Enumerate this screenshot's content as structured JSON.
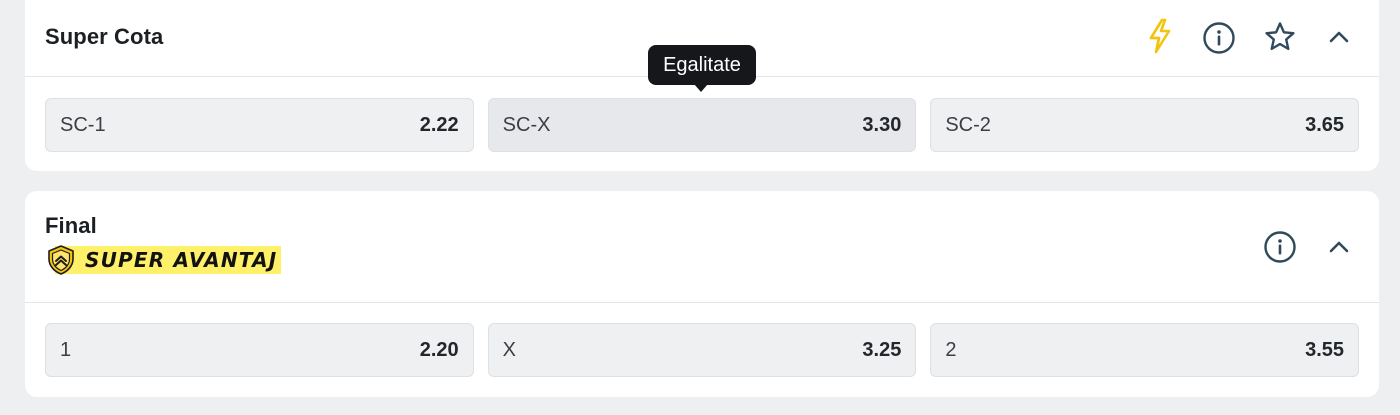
{
  "super_cota": {
    "title": "Super Cota",
    "tooltip": "Egalitate",
    "outcomes": [
      {
        "label": "SC-1",
        "odd": "2.22"
      },
      {
        "label": "SC-X",
        "odd": "3.30"
      },
      {
        "label": "SC-2",
        "odd": "3.65"
      }
    ],
    "icons": [
      "lightning-icon",
      "info-icon",
      "star-icon",
      "chevron-up-icon"
    ]
  },
  "final": {
    "title": "Final",
    "badge": "SUPER AVANTAJ",
    "outcomes": [
      {
        "label": "1",
        "odd": "2.20"
      },
      {
        "label": "X",
        "odd": "3.25"
      },
      {
        "label": "2",
        "odd": "3.55"
      }
    ],
    "icons": [
      "info-icon",
      "chevron-up-icon"
    ]
  },
  "colors": {
    "page_background": "#eeeff1",
    "card_background": "#ffffff",
    "odd_button_background": "#eef0f2",
    "lightning": "#f2c40f",
    "badge_background": "#fff06a",
    "tooltip_background": "#15171a",
    "icon_stroke": "#2f4a5a"
  }
}
